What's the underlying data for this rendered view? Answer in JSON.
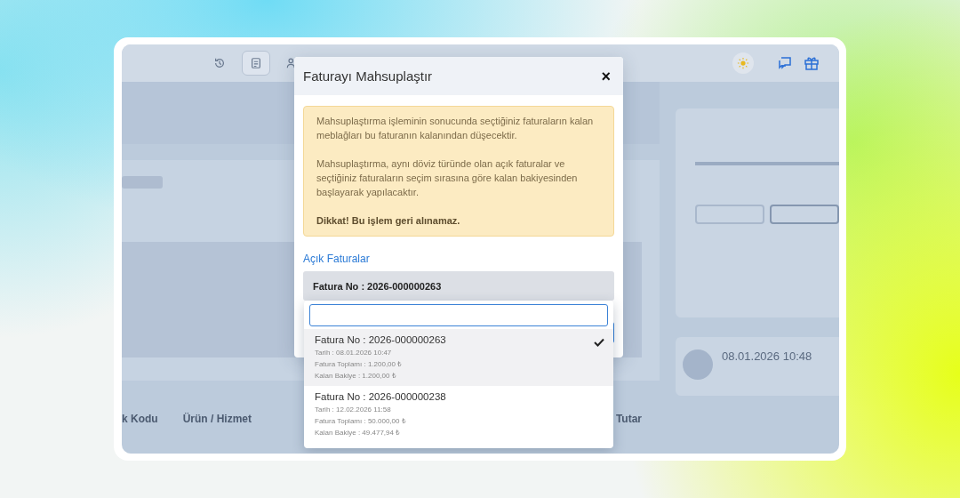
{
  "toolbar": [
    {
      "selected": false
    },
    {
      "selected": true
    },
    {
      "selected": false
    }
  ],
  "background": {
    "table_headers": [
      "k Kodu",
      "Ürün / Hizmet",
      "Tutar"
    ],
    "activity_time": "08.01.2026 10:48"
  },
  "modal": {
    "title": "Faturayı Mahsuplaştır",
    "close": "×",
    "alert": {
      "paragraphs": [
        "Mahsuplaştırma işleminin sonucunda seçtiğiniz faturaların kalan meblağları bu faturanın kalanından düşecektir.",
        "Mahsuplaştırma, aynı döviz türünde olan açık faturalar ve seçtiğiniz faturaların seçim sırasına göre kalan bakiyesinden başlayarak yapılacaktır."
      ],
      "warning": "Dikkat! Bu işlem geri alınamaz."
    },
    "label": "Açık Faturalar",
    "select": {
      "value": "Fatura No : 2026-000000263"
    },
    "options": [
      {
        "title": "Fatura No : 2026-000000263",
        "lines": [
          "Tarih : 08.01.2026 10:47",
          "Fatura Toplamı : 1.200,00 ₺",
          "Kalan Bakiye : 1.200,00 ₺"
        ],
        "selected": true
      },
      {
        "title": "Fatura No : 2026-000000238",
        "lines": [
          "Tarih : 12.02.2026 11:58",
          "Fatura Toplamı : 50.000,00 ₺",
          "Kalan Bakiye : 49.477,94 ₺"
        ],
        "selected": false
      }
    ]
  }
}
